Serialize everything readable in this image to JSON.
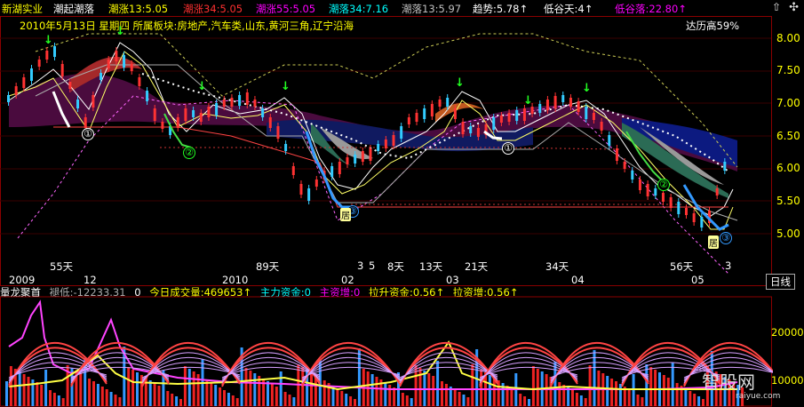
{
  "topbar": {
    "stock_name": "新湖实业",
    "indicator_name": "潮起潮落",
    "tide13": "潮涨13:5.05",
    "tide34": "潮涨34:5.05",
    "tide55": "潮涨55:5.05",
    "ebb34": "潮落34:7.16",
    "ebb13": "潮落13:5.97",
    "trend": "趋势:5.78↑",
    "low_valley": "低谷天:4↑",
    "low_valley_drop": "低谷落:22.80↑",
    "colors": {
      "stock_name": "#ffff00",
      "indicator": "#ffffff",
      "tide13": "#ffff00",
      "tide34": "#ff3030",
      "tide55": "#ff00ff",
      "ebb34": "#00ffff",
      "ebb13": "#c0c0c0",
      "trend": "#ffffff",
      "low": "#ffffff",
      "low_drop": "#ff00ff"
    }
  },
  "info_line": {
    "date": "2010年5月13日",
    "weekday": "星期四",
    "sectors": "所属板块:房地产,汽车类,山东,黄河三角,辽宁沿海",
    "high_note": "达历高59%"
  },
  "price_axis": [
    "8.00",
    "7.50",
    "7.00",
    "6.50",
    "6.00",
    "5.50",
    "5.00"
  ],
  "cycle_labels": [
    "55天",
    "89天",
    "3",
    "5",
    "8天",
    "13天",
    "21天",
    "34天",
    "56天",
    "3"
  ],
  "date_axis": [
    "2009",
    "12",
    "2010",
    "02",
    "03",
    "04",
    "05"
  ],
  "period_button": "日线",
  "indicator_bar": {
    "name": "量龙聚首",
    "low_value": "褪低:-12233.31",
    "zero": "0",
    "today_volume": "今日成交量:469653↑",
    "main_capital": "主力资金:0",
    "main_increase": "主资增:0",
    "lift_capital": "拉升资金:0.56↑",
    "lift_increase": "拉资增:0.56↑"
  },
  "sub_axis": [
    "20000",
    "10000"
  ],
  "markers": [
    "①",
    "②",
    "③",
    "①",
    "②",
    "③"
  ],
  "ju_marks": [
    "居",
    "居"
  ],
  "watermark": {
    "text": "智股网",
    "sub": "raiyue.com"
  },
  "icons": {
    "arrow": "up-arrow-icon",
    "settings": "settings-icon"
  }
}
